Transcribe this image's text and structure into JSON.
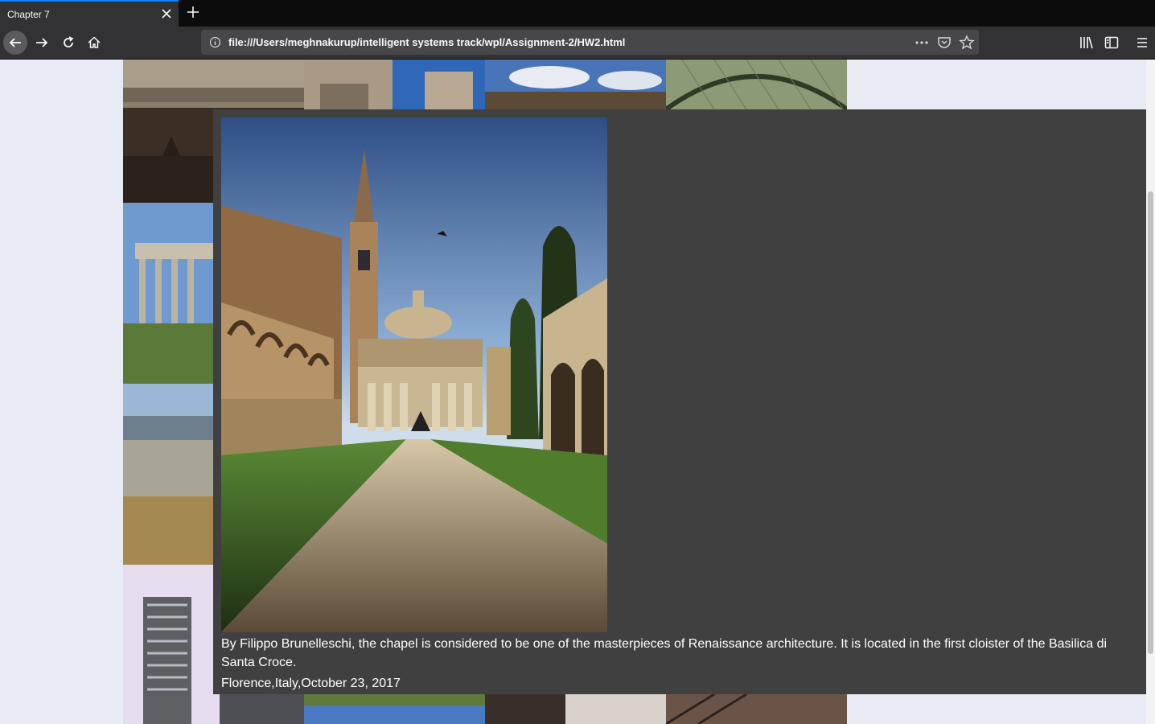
{
  "browser": {
    "tab_title": "Chapter 7",
    "url": "file:///Users/meghnakurup/intelligent systems track/wpl/Assignment-2/HW2.html",
    "icons": [
      "close-icon",
      "plus-icon",
      "back-arrow-icon",
      "forward-arrow-icon",
      "reload-icon",
      "home-icon",
      "info-icon",
      "more-icon",
      "pocket-icon",
      "star-icon",
      "library-icon",
      "sidebar-icon",
      "menu-icon"
    ]
  },
  "lightbox": {
    "caption": "By Filippo Brunelleschi, the chapel is considered to be one of the masterpieces of Renaissance architecture. It is located in the first cloister of the Basilica di Santa Croce.",
    "meta": "Florence,Italy,October 23, 2017"
  }
}
